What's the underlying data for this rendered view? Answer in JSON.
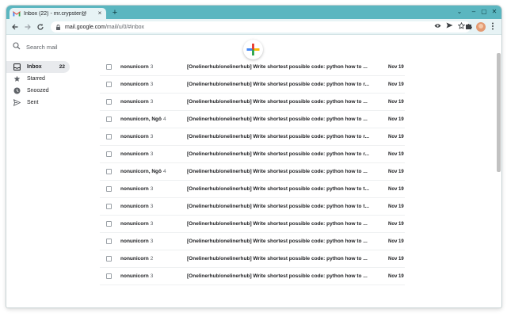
{
  "browser": {
    "tab_title": "Inbox (22) - mr.crypster@",
    "tab_close": "×",
    "new_tab": "+",
    "url_domain": "mail.google.com",
    "url_path": "/mail/u/0/#inbox",
    "window_controls": [
      "⌄",
      "–",
      "▢",
      "✕"
    ]
  },
  "search": {
    "placeholder": "Search mail"
  },
  "sidebar": {
    "items": [
      {
        "label": "Inbox",
        "count": "22",
        "icon": "inbox-icon"
      },
      {
        "label": "Starred",
        "count": "",
        "icon": "star-icon"
      },
      {
        "label": "Snoozed",
        "count": "",
        "icon": "clock-icon"
      },
      {
        "label": "Sent",
        "count": "",
        "icon": "send-icon"
      }
    ]
  },
  "emails": [
    {
      "sender": "nonunicorn",
      "count": "3",
      "subject": "[Onelinerhub/onelinerhub] Write shortest possible code: python how to ...",
      "date": "Nov 19"
    },
    {
      "sender": "nonunicorn",
      "count": "3",
      "subject": "[Onelinerhub/onelinerhub] Write shortest possible code: python how to r...",
      "date": "Nov 19"
    },
    {
      "sender": "nonunicorn",
      "count": "3",
      "subject": "[Onelinerhub/onelinerhub] Write shortest possible code: python how to ...",
      "date": "Nov 19"
    },
    {
      "sender": "nonunicorn, Ngô",
      "count": "4",
      "subject": "[Onelinerhub/onelinerhub] Write shortest possible code: python how to ...",
      "date": "Nov 19"
    },
    {
      "sender": "nonunicorn",
      "count": "3",
      "subject": "[Onelinerhub/onelinerhub] Write shortest possible code: python how to r...",
      "date": "Nov 19"
    },
    {
      "sender": "nonunicorn",
      "count": "3",
      "subject": "[Onelinerhub/onelinerhub] Write shortest possible code: python how to r...",
      "date": "Nov 19"
    },
    {
      "sender": "nonunicorn, Ngô",
      "count": "4",
      "subject": "[Onelinerhub/onelinerhub] Write shortest possible code: python how to ...",
      "date": "Nov 19"
    },
    {
      "sender": "nonunicorn",
      "count": "3",
      "subject": "[Onelinerhub/onelinerhub] Write shortest possible code: python how to t...",
      "date": "Nov 19"
    },
    {
      "sender": "nonunicorn",
      "count": "3",
      "subject": "[Onelinerhub/onelinerhub] Write shortest possible code: python how to t...",
      "date": "Nov 19"
    },
    {
      "sender": "nonunicorn",
      "count": "3",
      "subject": "[Onelinerhub/onelinerhub] Write shortest possible code: python how to ...",
      "date": "Nov 19"
    },
    {
      "sender": "nonunicorn",
      "count": "3",
      "subject": "[Onelinerhub/onelinerhub] Write shortest possible code: python how to ...",
      "date": "Nov 19"
    },
    {
      "sender": "nonunicorn",
      "count": "2",
      "subject": "[Onelinerhub/onelinerhub] Write shortest possible code: python how to ...",
      "date": "Nov 19"
    },
    {
      "sender": "nonunicorn",
      "count": "3",
      "subject": "[Onelinerhub/onelinerhub] Write shortest possible code: python how to ...",
      "date": "Nov 19"
    }
  ],
  "colors": {
    "tabstrip": "#5bb6c0",
    "toolbar": "#e7f3f5",
    "active_nav": "#e8eaed",
    "gmail_red": "#ea4335",
    "gmail_blue": "#4285f4",
    "gmail_green": "#34a853",
    "gmail_yellow": "#fbbc04"
  }
}
